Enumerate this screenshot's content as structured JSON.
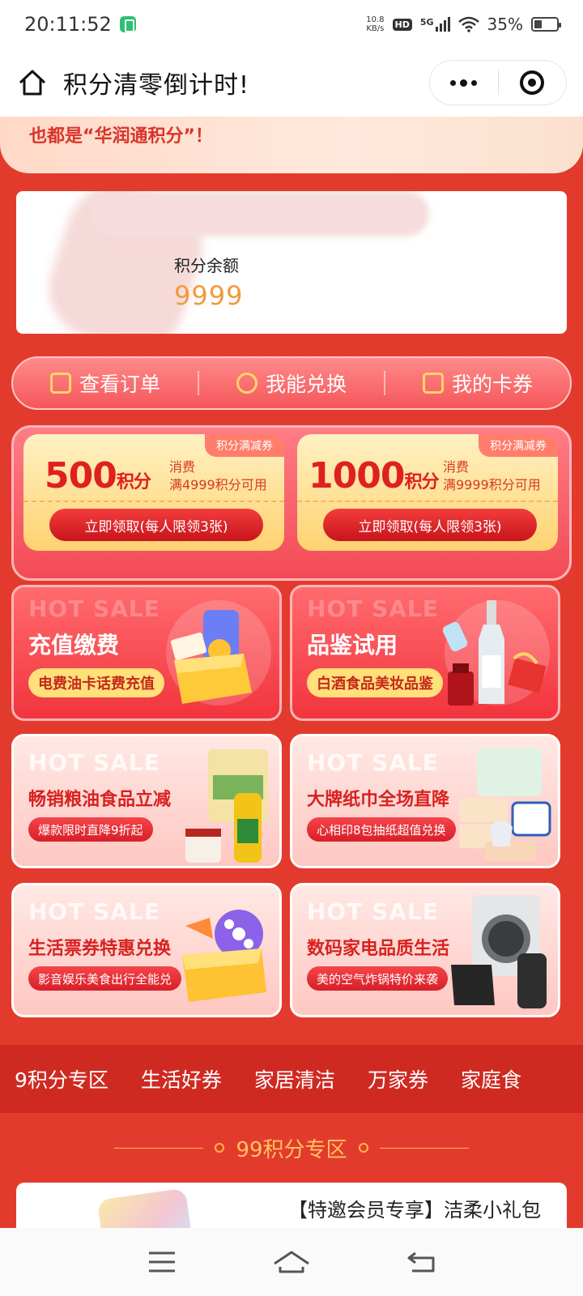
{
  "status": {
    "time": "20:11:52",
    "net_speed_value": "10.8",
    "net_speed_unit": "KB/s",
    "hd": "HD",
    "network": "5G",
    "battery_text": "35%",
    "battery_level": 0.35
  },
  "nav": {
    "title": "积分清零倒计时!"
  },
  "notice": {
    "text": "也都是“华润通积分”！"
  },
  "points": {
    "label": "积分余额",
    "value": "9999"
  },
  "actions": [
    {
      "label": "查看订单",
      "icon": "order-icon"
    },
    {
      "label": "我能兑换",
      "icon": "exchange-icon"
    },
    {
      "label": "我的卡券",
      "icon": "ticket-icon"
    }
  ],
  "coupons": [
    {
      "tag": "积分满减券",
      "amount": "500",
      "unit": "积分",
      "cond_top": "消费",
      "cond_bottom": "满4999积分可用",
      "button": "立即领取",
      "button_note": "(每人限领3张)"
    },
    {
      "tag": "积分满减券",
      "amount": "1000",
      "unit": "积分",
      "cond_top": "消费",
      "cond_bottom": "满9999积分可用",
      "button": "立即领取",
      "button_note": "(每人限领3张)"
    }
  ],
  "tiles": [
    {
      "hot": "HOT SALE",
      "title": "充值缴费",
      "sub": "电费油卡话费充值"
    },
    {
      "hot": "HOT SALE",
      "title": "品鉴试用",
      "sub": "白酒食品美妆品鉴"
    },
    {
      "hot": "HOT SALE",
      "title": "畅销粮油食品立减",
      "sub": "爆款限时直降9折起"
    },
    {
      "hot": "HOT SALE",
      "title": "大牌纸巾全场直降",
      "sub": "心相印8包抽纸超值兑换"
    },
    {
      "hot": "HOT SALE",
      "title": "生活票券特惠兑换",
      "sub": "影音娱乐美食出行全能兑"
    },
    {
      "hot": "HOT SALE",
      "title": "数码家电品质生活",
      "sub": "美的空气炸锅特价来袭"
    }
  ],
  "categories": [
    "9积分专区",
    "生活好券",
    "家居清洁",
    "万家券",
    "家庭食"
  ],
  "section": {
    "title": "99积分专区"
  },
  "product": {
    "name": "【特邀会员专享】洁柔小礼包"
  },
  "colors": {
    "background": "#e23b2e",
    "accent_red": "#e01f21",
    "points_value": "#f19a3e",
    "gold": "#ffc35c"
  }
}
